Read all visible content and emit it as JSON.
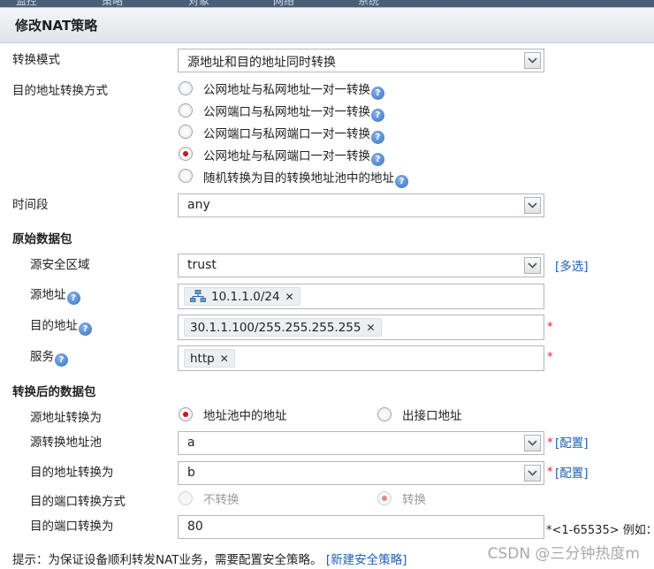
{
  "top_nav": [
    "监控",
    "策略",
    "对象",
    "网络",
    "系统"
  ],
  "dialog_title": "修改NAT策略",
  "conversion_mode": {
    "label": "转换模式",
    "value": "源地址和目的地址同时转换"
  },
  "dest_conversion": {
    "label": "目的地址转换方式",
    "options": [
      {
        "label": "公网地址与私网地址一对一转换",
        "selected": false
      },
      {
        "label": "公网端口与私网地址一对一转换",
        "selected": false
      },
      {
        "label": "公网端口与私网端口一对一转换",
        "selected": false
      },
      {
        "label": "公网地址与私网端口一对一转换",
        "selected": true
      },
      {
        "label": "随机转换为目的转换地址池中的地址",
        "selected": false
      }
    ]
  },
  "time_range": {
    "label": "时间段",
    "value": "any"
  },
  "original_packet": {
    "section_title": "原始数据包",
    "source_zone": {
      "label": "源安全区域",
      "value": "trust",
      "link": "[多选]"
    },
    "source_address": {
      "label": "源地址",
      "tag": "10.1.1.0/24"
    },
    "dest_address": {
      "label": "目的地址",
      "tag": "30.1.1.100/255.255.255.255",
      "required": "*"
    },
    "service": {
      "label": "服务",
      "tag": "http",
      "required": "*"
    }
  },
  "translated_packet": {
    "section_title": "转换后的数据包",
    "source_translate": {
      "label": "源地址转换为",
      "options": [
        {
          "label": "地址池中的地址",
          "selected": true
        },
        {
          "label": "出接口地址",
          "selected": false
        }
      ]
    },
    "source_pool": {
      "label": "源转换地址池",
      "value": "a",
      "required": "*",
      "link": "[配置]"
    },
    "dest_translate": {
      "label": "目的地址转换为",
      "value": "b",
      "required": "*",
      "link": "[配置]"
    },
    "dest_port_mode": {
      "label": "目的端口转换方式",
      "options": [
        {
          "label": "不转换",
          "selected": false
        },
        {
          "label": "转换",
          "selected": true
        }
      ]
    },
    "dest_port": {
      "label": "目的端口转换为",
      "value": "80",
      "range_hint": "*<1-65535> 例如："
    }
  },
  "hint": {
    "text": "提示：为保证设备顺利转发NAT业务，需要配置安全策略。",
    "link": "[新建安全策略]"
  },
  "watermark": "CSDN @三分钟热度m",
  "colors": {
    "accent_red": "#c8161d",
    "link_blue": "#1d5fb8",
    "help_blue": "#2f6fc4"
  }
}
